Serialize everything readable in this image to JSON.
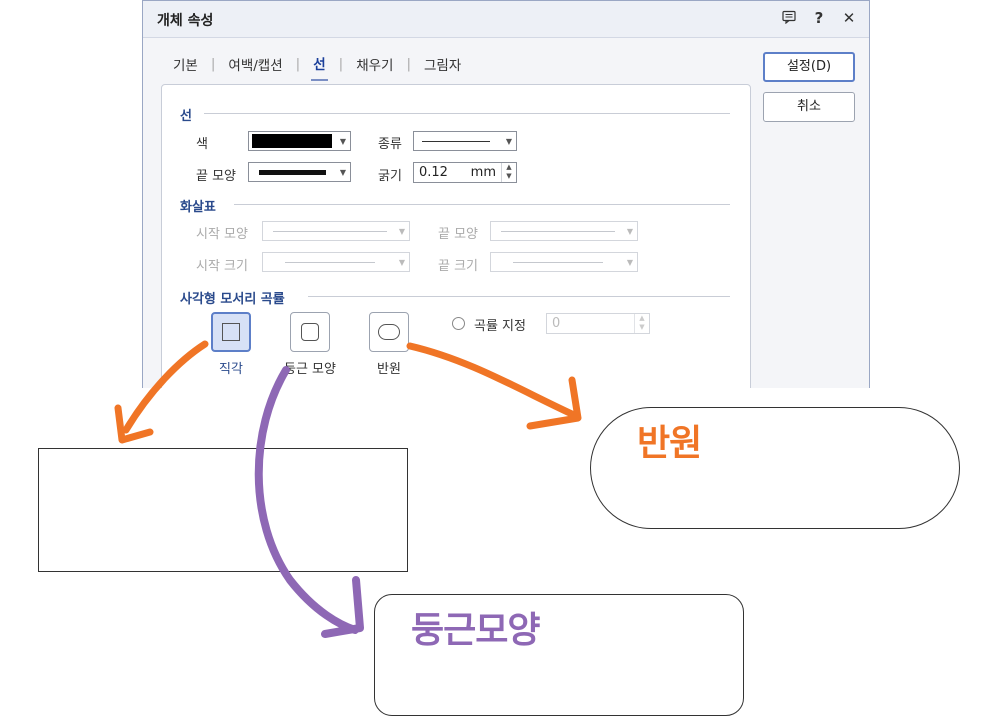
{
  "dialog": {
    "title": "개체 속성",
    "icons": [
      "comment-icon",
      "help-icon",
      "close-icon"
    ],
    "tabs": [
      {
        "label": "기본",
        "active": false
      },
      {
        "label": "여백/캡션",
        "active": false
      },
      {
        "label": "선",
        "active": true
      },
      {
        "label": "채우기",
        "active": false
      },
      {
        "label": "그림자",
        "active": false
      }
    ],
    "buttons": {
      "ok": "설정(D)",
      "cancel": "취소"
    },
    "line_section": {
      "title": "선",
      "color_label": "색",
      "color_value": "#000000",
      "type_label": "종류",
      "end_label": "끝 모양",
      "width_label": "굵기",
      "width_value": "0.12",
      "width_unit": "mm"
    },
    "arrow_section": {
      "title": "화살표",
      "start_shape_label": "시작 모양",
      "end_shape_label": "끝 모양",
      "start_size_label": "시작 크기",
      "end_size_label": "끝 크기"
    },
    "corner_section": {
      "title": "사각형 모서리 곡률",
      "options": [
        {
          "label": "직각",
          "selected": true
        },
        {
          "label": "둥근 모양",
          "selected": false
        },
        {
          "label": "반원",
          "selected": false
        }
      ],
      "custom_label": "곡률 지정",
      "custom_value": "0"
    }
  },
  "annotations": {
    "semicircle_label": "반원",
    "rounded_label": "둥근모양",
    "colors": {
      "orange": "#f07526",
      "purple": "#8e68b5"
    }
  }
}
